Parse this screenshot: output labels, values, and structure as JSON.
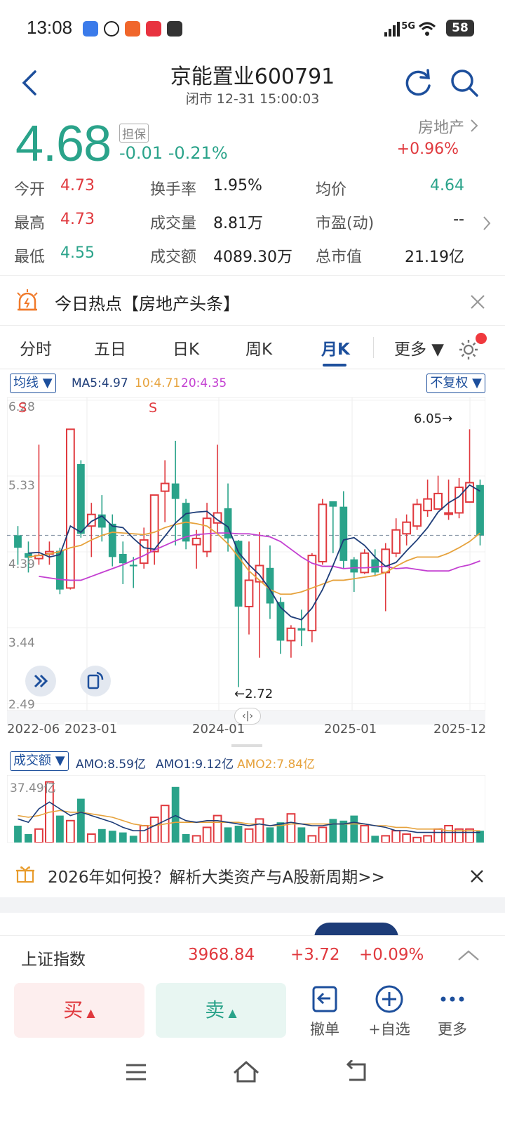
{
  "status": {
    "time": "13:08",
    "network": "5G",
    "battery": "58"
  },
  "header": {
    "title": "京能置业600791",
    "subtitle": "闭市 12-31 15:00:03"
  },
  "quote": {
    "price": "4.68",
    "margin_badge": "担保",
    "change": "-0.01  -0.21%",
    "sector": "房地产",
    "sector_change": "+0.96%",
    "open_label": "今开",
    "open": "4.73",
    "high_label": "最高",
    "high": "4.73",
    "low_label": "最低",
    "low": "4.55",
    "turnover_label": "换手率",
    "turnover": "1.95%",
    "volume_label": "成交量",
    "volume": "8.81万",
    "amount_label": "成交额",
    "amount": "4089.30万",
    "avg_label": "均价",
    "avg": "4.64",
    "pe_label": "市盈(动)",
    "pe": "--",
    "mcap_label": "总市值",
    "mcap": "21.19亿"
  },
  "hot": {
    "text": "今日热点【房地产头条】"
  },
  "tabs": [
    "分时",
    "五日",
    "日K",
    "周K",
    "月K",
    "更多 ▼"
  ],
  "active_tab": "月K",
  "chart": {
    "ma_selector": "均线 ▼",
    "ma5": "MA5:4.97",
    "ma10": "10:4.71",
    "ma20": "20:4.35",
    "adjust_selector": "不复权 ▼",
    "y_ticks": [
      "6.28",
      "5.33",
      "4.39",
      "3.44",
      "2.49"
    ],
    "x_ticks": [
      "2022-06",
      "2023-01",
      "2024-01",
      "2025-01",
      "2025-12"
    ],
    "max_label": "6.05→",
    "min_label": "←2.72",
    "s_marker": "S",
    "vol_selector": "成交额 ▼",
    "amo": "AMO:8.59亿",
    "amo1": "AMO1:9.12亿",
    "amo2": "AMO2:7.84亿",
    "vol_max": "37.49亿",
    "colors": {
      "up": "#e0393e",
      "down": "#2aa38a",
      "ma5": "#1d3c78",
      "ma10": "#e6a23c",
      "ma20": "#c33fd1"
    }
  },
  "chart_data": {
    "type": "candlestick",
    "period": "monthly",
    "ylim": [
      2.49,
      6.28
    ],
    "candles": [
      {
        "o": 4.68,
        "c": 4.52,
        "h": 4.8,
        "l": 4.3
      },
      {
        "o": 4.45,
        "c": 4.39,
        "h": 4.6,
        "l": 4.2
      },
      {
        "o": 4.38,
        "c": 4.42,
        "h": 5.85,
        "l": 4.3
      },
      {
        "o": 4.44,
        "c": 4.47,
        "h": 4.6,
        "l": 4.3
      },
      {
        "o": 4.48,
        "c": 3.98,
        "h": 4.52,
        "l": 3.92
      },
      {
        "o": 4.0,
        "c": 6.05,
        "h": 6.05,
        "l": 3.98
      },
      {
        "o": 5.6,
        "c": 4.7,
        "h": 5.65,
        "l": 4.65
      },
      {
        "o": 4.8,
        "c": 4.95,
        "h": 5.1,
        "l": 4.4
      },
      {
        "o": 4.95,
        "c": 4.78,
        "h": 5.2,
        "l": 4.6
      },
      {
        "o": 4.83,
        "c": 4.4,
        "h": 4.95,
        "l": 4.28
      },
      {
        "o": 4.44,
        "c": 4.32,
        "h": 4.6,
        "l": 4.05
      },
      {
        "o": 4.3,
        "c": 4.28,
        "h": 4.4,
        "l": 4.0
      },
      {
        "o": 4.32,
        "c": 4.62,
        "h": 4.78,
        "l": 4.25
      },
      {
        "o": 4.47,
        "c": 5.2,
        "h": 5.2,
        "l": 4.3
      },
      {
        "o": 5.25,
        "c": 5.35,
        "h": 5.65,
        "l": 4.85
      },
      {
        "o": 5.35,
        "c": 5.15,
        "h": 5.9,
        "l": 4.55
      },
      {
        "o": 5.1,
        "c": 4.6,
        "h": 5.15,
        "l": 4.5
      },
      {
        "o": 4.56,
        "c": 4.64,
        "h": 4.75,
        "l": 4.25
      },
      {
        "o": 4.47,
        "c": 4.9,
        "h": 5.1,
        "l": 4.4
      },
      {
        "o": 4.84,
        "c": 4.97,
        "h": 5.85,
        "l": 4.7
      },
      {
        "o": 5.03,
        "c": 4.64,
        "h": 5.35,
        "l": 4.47
      },
      {
        "o": 4.61,
        "c": 3.76,
        "h": 4.62,
        "l": 2.72
      },
      {
        "o": 3.76,
        "c": 4.1,
        "h": 4.6,
        "l": 3.4
      },
      {
        "o": 4.08,
        "c": 4.29,
        "h": 4.72,
        "l": 3.1
      },
      {
        "o": 4.26,
        "c": 3.8,
        "h": 4.55,
        "l": 3.6
      },
      {
        "o": 3.82,
        "c": 3.32,
        "h": 3.88,
        "l": 3.15
      },
      {
        "o": 3.32,
        "c": 3.48,
        "h": 3.52,
        "l": 3.1
      },
      {
        "o": 3.48,
        "c": 3.45,
        "h": 3.72,
        "l": 3.25
      },
      {
        "o": 3.45,
        "c": 4.42,
        "h": 4.45,
        "l": 3.3
      },
      {
        "o": 4.34,
        "c": 5.08,
        "h": 5.15,
        "l": 4.3
      },
      {
        "o": 5.12,
        "c": 5.05,
        "h": 5.1,
        "l": 4.45
      },
      {
        "o": 5.05,
        "c": 4.35,
        "h": 5.25,
        "l": 4.25
      },
      {
        "o": 4.37,
        "c": 4.2,
        "h": 4.4,
        "l": 3.95
      },
      {
        "o": 4.2,
        "c": 4.45,
        "h": 4.5,
        "l": 4.18
      },
      {
        "o": 4.37,
        "c": 4.2,
        "h": 4.5,
        "l": 4.15
      },
      {
        "o": 4.2,
        "c": 4.5,
        "h": 4.58,
        "l": 3.7
      },
      {
        "o": 4.45,
        "c": 4.75,
        "h": 4.9,
        "l": 4.4
      },
      {
        "o": 4.7,
        "c": 4.85,
        "h": 4.95,
        "l": 4.55
      },
      {
        "o": 4.8,
        "c": 5.08,
        "h": 5.15,
        "l": 4.75
      },
      {
        "o": 5.0,
        "c": 5.15,
        "h": 5.4,
        "l": 4.92
      },
      {
        "o": 5.02,
        "c": 5.22,
        "h": 5.45,
        "l": 5.02
      },
      {
        "o": 4.97,
        "c": 4.97,
        "h": 5.4,
        "l": 4.88
      },
      {
        "o": 4.97,
        "c": 5.3,
        "h": 5.42,
        "l": 4.9
      },
      {
        "o": 5.11,
        "c": 5.36,
        "h": 6.05,
        "l": 5.1
      },
      {
        "o": 5.33,
        "c": 4.68,
        "h": 5.4,
        "l": 4.55
      }
    ],
    "ma5": [
      4.45,
      4.46,
      4.4,
      4.43,
      4.8,
      4.72,
      4.86,
      4.93,
      4.8,
      4.78,
      4.64,
      4.52,
      4.5,
      4.67,
      4.84,
      4.96,
      4.98,
      4.99,
      4.88,
      4.79,
      4.46,
      4.3,
      4.17,
      3.98,
      3.75,
      3.63,
      3.59,
      3.74,
      3.98,
      4.29,
      4.62,
      4.65,
      4.55,
      4.4,
      4.28,
      4.33,
      4.48,
      4.62,
      4.78,
      4.98,
      5.1,
      5.18,
      5.33,
      5.25
    ],
    "ma10": [
      4.4,
      4.42,
      4.44,
      4.47,
      4.52,
      4.55,
      4.62,
      4.68,
      4.72,
      4.71,
      4.7,
      4.69,
      4.72,
      4.78,
      4.82,
      4.85,
      4.83,
      4.8,
      4.7,
      4.57,
      4.4,
      4.22,
      4.1,
      3.98,
      3.92,
      3.92,
      3.95,
      4.0,
      4.05,
      4.1,
      4.1,
      4.12,
      4.14,
      4.16,
      4.2,
      4.28,
      4.35,
      4.4,
      4.4,
      4.4,
      4.45,
      4.52,
      4.6,
      4.71
    ],
    "ma20": [
      4.15,
      4.13,
      4.11,
      4.1,
      4.1,
      4.15,
      4.2,
      4.25,
      4.3,
      4.36,
      4.42,
      4.49,
      4.55,
      4.61,
      4.66,
      4.69,
      4.7,
      4.71,
      4.71,
      4.7,
      4.7,
      4.68,
      4.66,
      4.6,
      4.5,
      4.4,
      4.32,
      4.28,
      4.28,
      4.25,
      4.26,
      4.26,
      4.27,
      4.28,
      4.25,
      4.26,
      4.24,
      4.22,
      4.22,
      4.22,
      4.27,
      4.3,
      4.35
    ],
    "amount": [
      10,
      5,
      8,
      36,
      16,
      13,
      26,
      5,
      8,
      7,
      6,
      4,
      10,
      15,
      22,
      33,
      5,
      4,
      9,
      16,
      9,
      10,
      8,
      14,
      9,
      12,
      17,
      9,
      4,
      9,
      14,
      13,
      16,
      10,
      4,
      4,
      7,
      5,
      3,
      4,
      8,
      10,
      8,
      8,
      7
    ],
    "amo1": [
      14,
      12,
      20,
      24,
      20,
      16,
      18,
      16,
      14,
      12,
      9,
      7,
      7,
      10,
      13,
      16,
      13,
      12,
      13,
      13,
      12,
      11,
      10,
      11,
      10,
      11,
      12,
      11,
      10,
      10,
      11,
      11,
      12,
      11,
      10,
      9,
      7,
      7,
      6,
      6,
      6,
      6,
      6,
      6,
      6
    ],
    "amo2": [
      16,
      15,
      16,
      18,
      19,
      18,
      18,
      17,
      16,
      15,
      13,
      11,
      10,
      10,
      11,
      12,
      12,
      12,
      12,
      12,
      12,
      12,
      11,
      11,
      10,
      10,
      11,
      11,
      11,
      11,
      11,
      11,
      11,
      11,
      10,
      10,
      9,
      9,
      8,
      8,
      8,
      7,
      7,
      7,
      7
    ],
    "vol_ylim": [
      0,
      37.49
    ]
  },
  "promo": {
    "text": "2026年如何投？解析大类资产与A股新周期>>"
  },
  "index": {
    "name": "上证指数",
    "value": "3968.84",
    "change": "+3.72",
    "pct": "+0.09%"
  },
  "actions": {
    "buy": "买",
    "sell": "卖",
    "cancel": "撤单",
    "watch": "+自选",
    "more": "更多"
  }
}
